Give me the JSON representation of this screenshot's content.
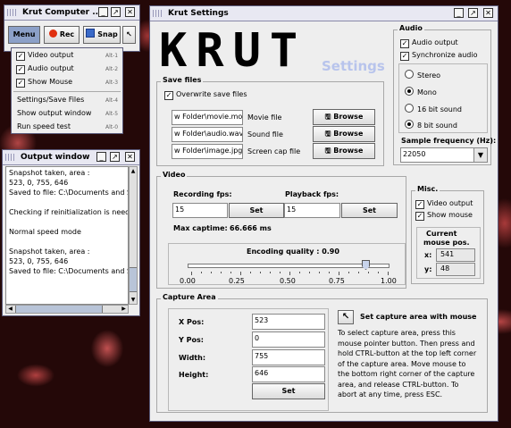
{
  "main_window": {
    "title": "Krut Computer ...",
    "menu_label": "Menu",
    "rec_label": "Rec",
    "snap_label": "Snap",
    "menu_items": [
      {
        "label": "Video output",
        "shortcut": "Alt-1",
        "checked": true
      },
      {
        "label": "Audio output",
        "shortcut": "Alt-2",
        "checked": true
      },
      {
        "label": "Show Mouse",
        "shortcut": "Alt-3",
        "checked": true
      },
      {
        "label": "Settings/Save Files",
        "shortcut": "Alt-4"
      },
      {
        "label": "Show output window",
        "shortcut": "Alt-5"
      },
      {
        "label": "Run speed test",
        "shortcut": "Alt-0"
      }
    ]
  },
  "output_window": {
    "title": "Output window",
    "lines": [
      "Snapshot taken, area :",
      " 523, 0, 755, 646",
      "Saved to file: C:\\Documents and S",
      "",
      "Checking if reinitialization is need",
      "",
      "Normal speed mode",
      "",
      "Snapshot taken, area :",
      " 523, 0, 755, 646",
      "Saved to file: C:\\Documents and S"
    ]
  },
  "settings": {
    "title": "Krut Settings",
    "logo_text": "KRUT",
    "logo_sub": "Settings",
    "save_files": {
      "group_label": "Save files",
      "overwrite_label": "Overwrite save files",
      "browse_label": "Browse",
      "files": [
        {
          "path": "w Folder\\movie.mov",
          "label": "Movie file"
        },
        {
          "path": "w Folder\\audio.wav",
          "label": "Sound file"
        },
        {
          "path": "w Folder\\image.jpg",
          "label": "Screen cap file"
        }
      ]
    },
    "audio": {
      "group_label": "Audio",
      "audio_output": "Audio output",
      "synchronize": "Synchronize audio",
      "stereo": "Stereo",
      "mono": "Mono",
      "bit16": "16 bit sound",
      "bit8": "8 bit sound",
      "freq_label": "Sample frequency (Hz):",
      "freq_value": "22050"
    },
    "video": {
      "group_label": "Video",
      "rec_fps_label": "Recording fps:",
      "rec_fps_value": "15",
      "play_fps_label": "Playback fps:",
      "play_fps_value": "15",
      "set_label": "Set",
      "max_captime_label": "Max captime:",
      "max_captime_value": "66.666 ms",
      "quality_label": "Encoding quality : 0.90",
      "quality_value": 0.9,
      "ticks": [
        "0.00",
        "0.25",
        "0.50",
        "0.75",
        "1.00"
      ]
    },
    "misc": {
      "group_label": "Misc.",
      "video_output": "Video output",
      "show_mouse": "Show mouse",
      "mouse_pos_label_1": "Current",
      "mouse_pos_label_2": "mouse pos.",
      "x_label": "x:",
      "x_value": "541",
      "y_label": "y:",
      "y_value": "48"
    },
    "capture": {
      "group_label": "Capture Area",
      "xpos_label": "X Pos:",
      "xpos_value": "523",
      "ypos_label": "Y Pos:",
      "ypos_value": "0",
      "width_label": "Width:",
      "width_value": "755",
      "height_label": "Height:",
      "height_value": "646",
      "set_label": "Set",
      "set_area_label": "Set capture area with mouse",
      "help_lines": [
        "To select capture area, press this",
        "mouse pointer button. Then press and",
        "hold CTRL-button at the top left corner",
        "of the capture area. Move mouse to",
        "the bottom right corner of the capture",
        "area, and release CTRL-button. To",
        "abort at any time, press ESC."
      ]
    }
  }
}
